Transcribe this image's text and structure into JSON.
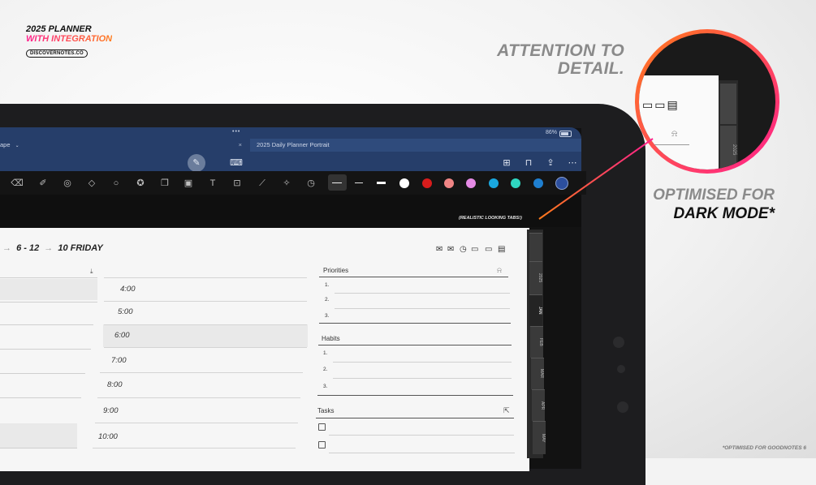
{
  "brand": {
    "line1": "2025 PLANNER",
    "line2": "WITH INTEGRATION",
    "site": "DISCOVERNOTES.CO"
  },
  "headline": {
    "line1": "ATTENTION TO",
    "line2": "DETAIL."
  },
  "dark_mode": {
    "line1": "OPTIMISED FOR",
    "line2": "DARK MODE*"
  },
  "footnote": "*OPTIMISED FOR GOODNOTES 6",
  "status": {
    "dots": "•••",
    "battery": "86%"
  },
  "tabs": [
    {
      "label": "ape"
    },
    {
      "label": "2025 Daily Planner Portrait"
    }
  ],
  "tab_close": "×",
  "realistic_label": "(REALISTIC LOOKING TABS!)",
  "breadcrumb": {
    "part1": "6 - 12",
    "part2": "10 FRIDAY",
    "arrow": "→"
  },
  "times": [
    "4:00",
    "5:00",
    "6:00",
    "7:00",
    "8:00",
    "9:00",
    "10:00"
  ],
  "priorities": {
    "title": "Priorities",
    "items": [
      "1.",
      "2.",
      "3."
    ]
  },
  "habits": {
    "title": "Habits",
    "items": [
      "1.",
      "2.",
      "3."
    ]
  },
  "tasks": {
    "title": "Tasks"
  },
  "side_tabs": [
    "2025",
    "JAN",
    "FEB",
    "MAR",
    "APR",
    "MAY"
  ],
  "zoom_tab": "2025",
  "colors": {
    "accent_pink": "#ff1f8e",
    "accent_orange": "#ff7a1a",
    "nav_blue": "#263e6a",
    "swatches": [
      "#ffffff",
      "#d81c1c",
      "#f08585",
      "#e58ae5",
      "#1aa8e0",
      "#2fd6c0",
      "#1f7fd0",
      "#2c4f9e"
    ]
  }
}
